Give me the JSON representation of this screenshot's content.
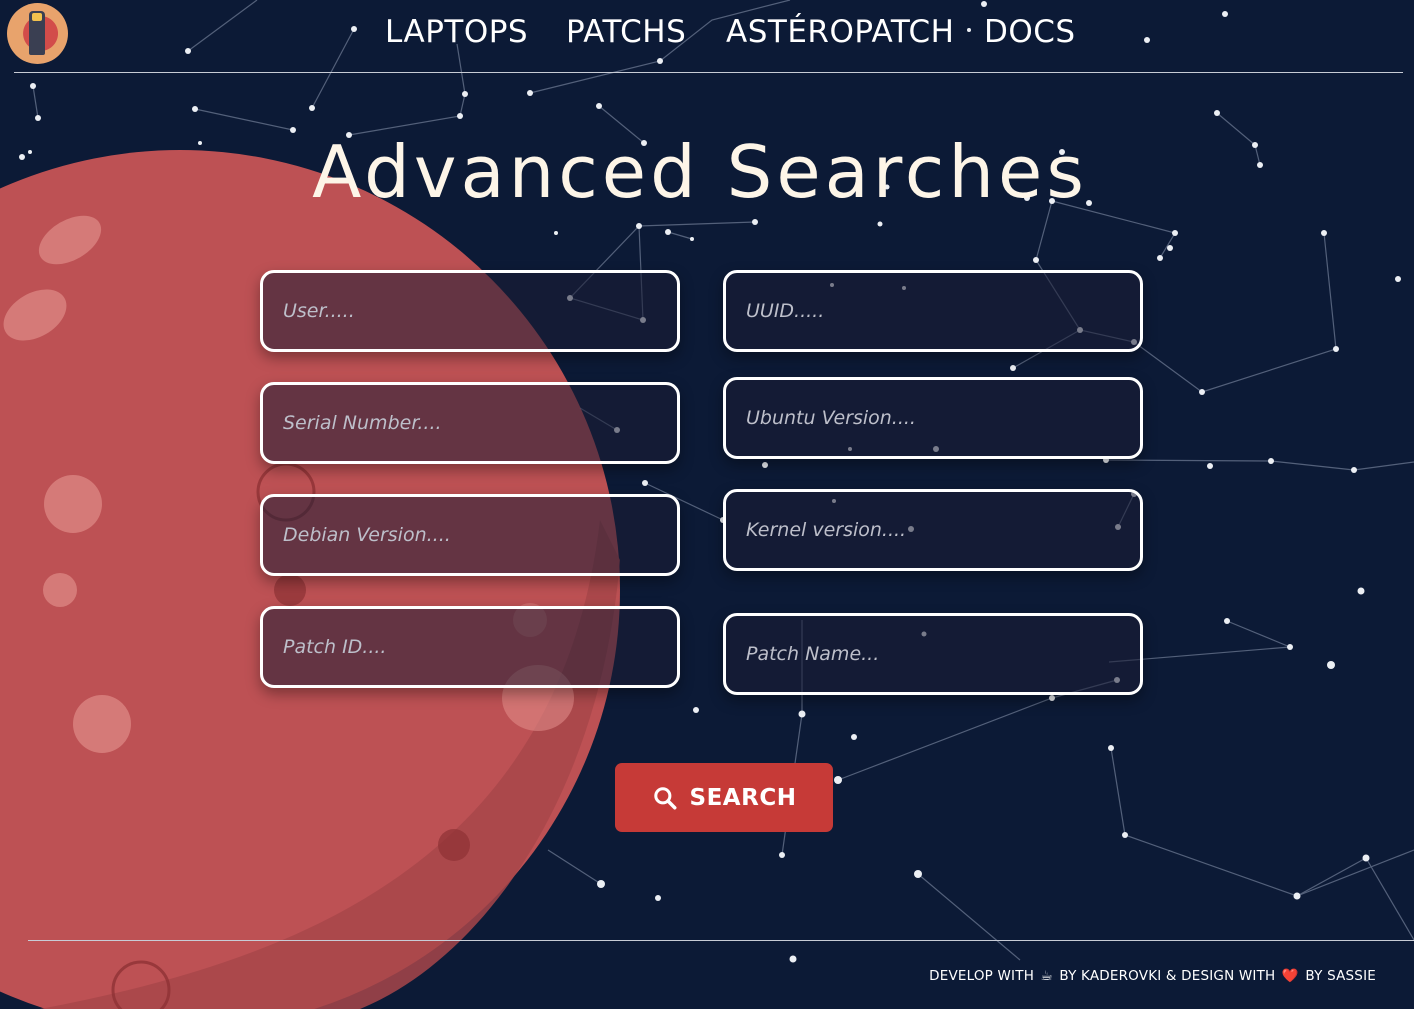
{
  "nav": {
    "items": [
      "LAPTOPS",
      "PATCHS",
      "ASTÉROPATCH",
      "DOCS"
    ]
  },
  "title": "Advanced Searches",
  "form": {
    "user_placeholder": "User.....",
    "uuid_placeholder": "UUID.....",
    "serial_placeholder": "Serial Number....",
    "ubuntu_placeholder": "Ubuntu Version....",
    "debian_placeholder": "Debian Version....",
    "kernel_placeholder": "Kernel version....",
    "patch_id_placeholder": "Patch ID....",
    "patch_name_placeholder": "Patch Name..."
  },
  "search_button": {
    "label": "SEARCH",
    "icon": "search-icon"
  },
  "footer": {
    "part1": "DEVELOP WITH",
    "icon1": "☕",
    "part2": "BY  KADEROVKI & DESIGN WITH",
    "icon2": "❤️",
    "part3": "BY SASSIE"
  },
  "colors": {
    "background": "#0c1a36",
    "planet": "#c9575a",
    "button": "#c63a37",
    "title": "#fdf5e8"
  }
}
